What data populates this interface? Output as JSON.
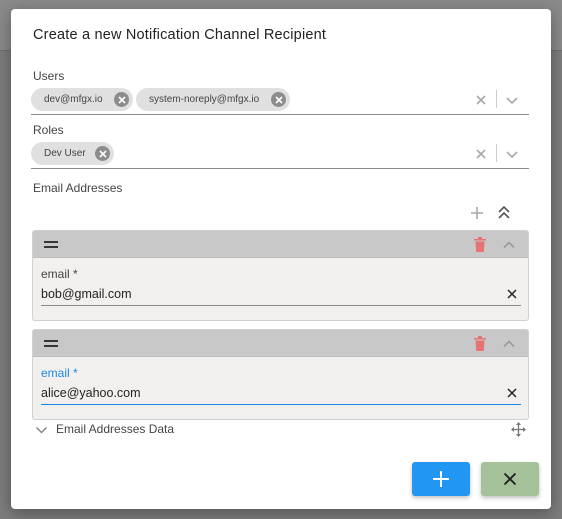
{
  "dialog": {
    "title": "Create a new Notification Channel Recipient"
  },
  "users": {
    "label": "Users",
    "chips": [
      "dev@mfgx.io",
      "system-noreply@mfgx.io"
    ]
  },
  "roles": {
    "label": "Roles",
    "chips": [
      "Dev User"
    ]
  },
  "email_addresses": {
    "label": "Email Addresses",
    "items": [
      {
        "label": "email *",
        "value": "bob@gmail.com"
      },
      {
        "label": "email *",
        "value": "alice@yahoo.com"
      }
    ],
    "data_toggle_label": "Email Addresses Data"
  },
  "icons": {
    "chip_remove": "close-circle-icon",
    "clear": "close-icon",
    "dropdown": "chevron-down-icon",
    "add": "plus-icon",
    "collapse_all": "double-chevron-up-icon",
    "drag": "drag-handle-icon",
    "delete": "trash-icon",
    "collapse": "chevron-up-icon",
    "move": "move-icon",
    "confirm": "plus-icon",
    "cancel": "close-icon"
  },
  "colors": {
    "primary": "#2196f3",
    "cancel": "#a5c19a",
    "delete": "#e57373",
    "focus": "#1e88e5"
  }
}
